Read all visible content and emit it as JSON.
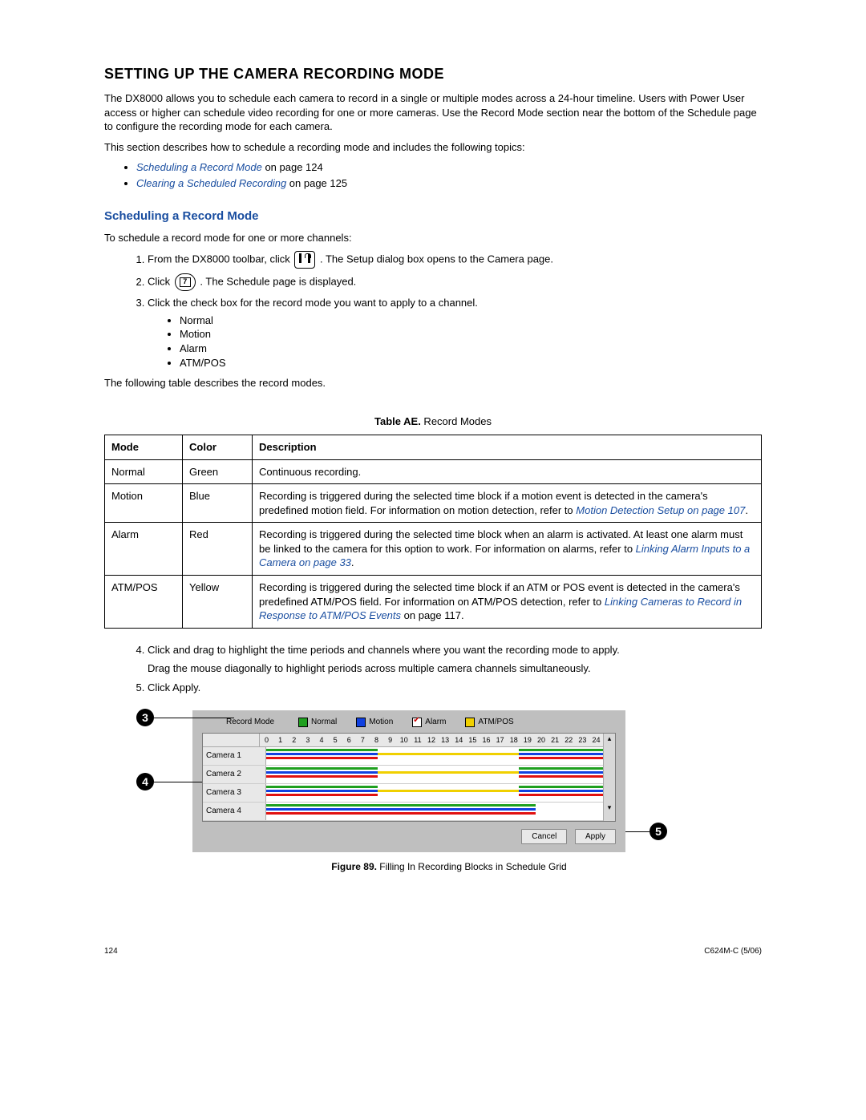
{
  "h1": "SETTING UP THE CAMERA RECORDING MODE",
  "intro1": "The DX8000 allows you to schedule each camera to record in a single or multiple modes across a 24-hour timeline. Users with Power User access or higher can schedule video recording for one or more cameras. Use the Record Mode section near the bottom of the Schedule page to configure the recording mode for each camera.",
  "intro2": "This section describes how to schedule a recording mode and includes the following topics:",
  "topic1_link": "Scheduling a Record Mode",
  "topic1_tail": " on page 124",
  "topic2_link": "Clearing a Scheduled Recording",
  "topic2_tail": " on page 125",
  "h2a": "Scheduling a Record Mode",
  "h2a_lead": "To schedule a record mode for one or more channels:",
  "step1_pre": "From the DX8000 toolbar, click ",
  "step1_post": ". The Setup dialog box opens to the Camera page.",
  "step2_pre": "Click ",
  "step2_post": ". The Schedule page is displayed.",
  "step3": "Click the check box for the record mode you want to apply to a channel.",
  "modes": {
    "a": "Normal",
    "b": "Motion",
    "c": "Alarm",
    "d": "ATM/POS"
  },
  "tablelead": "The following table describes the record modes.",
  "tabletitle_bold": "Table AE.",
  "tabletitle_rest": "  Record Modes",
  "th": {
    "mode": "Mode",
    "color": "Color",
    "desc": "Description"
  },
  "row1": {
    "mode": "Normal",
    "color": "Green",
    "desc": "Continuous recording."
  },
  "row2": {
    "mode": "Motion",
    "color": "Blue",
    "pre": "Recording is triggered during the selected time block if a motion event is detected in the camera's predefined motion field. For information on motion detection, refer to ",
    "link": "Motion Detection Setup on page 107",
    "post": "."
  },
  "row3": {
    "mode": "Alarm",
    "color": "Red",
    "pre": "Recording is triggered during the selected time block when an alarm is activated. At least one alarm must be linked to the camera for this option to work. For information on alarms, refer to ",
    "link": "Linking Alarm Inputs to a Camera on page 33",
    "post": "."
  },
  "row4": {
    "mode": "ATM/POS",
    "color": "Yellow",
    "pre": "Recording is triggered during the selected time block if an ATM or POS event is detected in the camera's predefined ATM/POS field. For information on ATM/POS detection, refer to ",
    "link": "Linking Cameras to Record in Response to ATM/POS Events",
    "post": " on page 117."
  },
  "step4a": "Click and drag to highlight the time periods and channels where you want the recording mode to apply.",
  "step4b": "Drag the mouse diagonally to highlight periods across multiple camera channels simultaneously.",
  "step5": "Click Apply.",
  "callouts": {
    "c3": "3",
    "c4": "4",
    "c5": "5"
  },
  "panel": {
    "record_mode_label": "Record Mode",
    "cb1": "Normal",
    "cb2": "Motion",
    "cb3": "Alarm",
    "cb4": "ATM/POS",
    "ticks": [
      "0",
      "1",
      "2",
      "3",
      "4",
      "5",
      "6",
      "7",
      "8",
      "9",
      "10",
      "11",
      "12",
      "13",
      "14",
      "15",
      "16",
      "17",
      "18",
      "19",
      "20",
      "21",
      "22",
      "23",
      "24"
    ],
    "cam1": "Camera 1",
    "cam2": "Camera 2",
    "cam3": "Camera 3",
    "cam4": "Camera 4",
    "cancel": "Cancel",
    "apply": "Apply"
  },
  "figcap_bold": "Figure 89.",
  "figcap_rest": "  Filling In Recording Blocks in Schedule Grid",
  "page_no": "124",
  "doc_id": "C624M-C (5/06)"
}
